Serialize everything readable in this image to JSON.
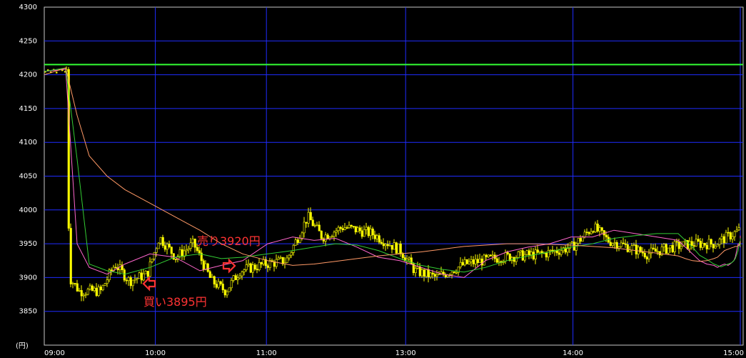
{
  "chart_data": {
    "type": "candlestick",
    "y_axis": {
      "ticks": [
        "4300",
        "4250",
        "4200",
        "4150",
        "4100",
        "4050",
        "4000",
        "3950",
        "3900",
        "3850"
      ],
      "unit_label": "(円)",
      "ylim": [
        3800,
        4300
      ]
    },
    "x_axis": {
      "ticks": [
        "09:00",
        "10:00",
        "11:00",
        "13:00",
        "14:00",
        "15:00"
      ]
    },
    "grid": true,
    "reference_line": {
      "value": 4215,
      "color": "#33ff33"
    },
    "candle_color": "#ffff00",
    "moving_averages": [
      {
        "color": "#ff66cc",
        "values": [
          4205,
          4208,
          3950,
          3915,
          3905,
          3920,
          3935,
          3930,
          3910,
          3918,
          3925,
          3950,
          3960,
          3955,
          3958,
          3945,
          3930,
          3925,
          3915,
          3905,
          3900,
          3925,
          3938,
          3945,
          3950,
          3960,
          3960,
          3970,
          3965,
          3960,
          3955,
          3945,
          3935,
          3925,
          3920,
          3918,
          3915,
          3918,
          3920,
          3918,
          3922,
          3925,
          3930,
          3940,
          3950,
          3950,
          3948,
          3945,
          3950,
          3955,
          3958,
          3960,
          3962
        ]
      },
      {
        "color": "#33cc33",
        "values": [
          4205,
          4210,
          4075,
          3920,
          3910,
          3905,
          3915,
          3930,
          3935,
          3928,
          3930,
          3935,
          3940,
          3945,
          3950,
          3948,
          3940,
          3928,
          3918,
          3912,
          3908,
          3915,
          3925,
          3932,
          3938,
          3945,
          3950,
          3958,
          3962,
          3965,
          3965,
          3955,
          3945,
          3933,
          3927,
          3920,
          3918,
          3916,
          3918,
          3920,
          3922,
          3925,
          3928,
          3934,
          3940,
          3948,
          3952,
          3948,
          3946,
          3948,
          3952,
          3955,
          3958
        ]
      },
      {
        "color": "#ff9966",
        "values": [
          4200,
          4210,
          4140,
          4080,
          4050,
          4030,
          4010,
          3990,
          3970,
          3950,
          3935,
          3925,
          3918,
          3920,
          3924,
          3928,
          3932,
          3935,
          3938,
          3942,
          3946,
          3948,
          3950,
          3950,
          3949,
          3948,
          3946,
          3944,
          3940,
          3936,
          3932,
          3928,
          3925,
          3924,
          3925,
          3928,
          3930,
          3935,
          3940,
          3942,
          3944,
          3945,
          3946,
          3946,
          3947,
          3948,
          3949,
          3950,
          3950,
          3951,
          3952,
          3953,
          3954
        ]
      }
    ],
    "ma_x": [
      "09:00",
      "09:10",
      "09:20",
      "09:30",
      "09:40",
      "09:50",
      "10:00",
      "10:10",
      "10:20",
      "10:30",
      "10:40",
      "10:50",
      "11:00",
      "11:10",
      "11:20",
      "11:30",
      "11:40",
      "11:50",
      "13:00",
      "13:10",
      "13:20",
      "13:30",
      "13:40",
      "13:50",
      "14:00",
      "14:10",
      "14:20",
      "14:30",
      "14:40",
      "14:50",
      "15:00",
      "15:00",
      "15:00",
      "15:00",
      "15:00",
      "15:00",
      "15:00",
      "15:00",
      "15:00",
      "15:00",
      "15:00",
      "15:00",
      "15:00",
      "15:00",
      "15:00",
      "15:00",
      "15:00",
      "15:00",
      "15:00",
      "15:00",
      "15:00",
      "15:00",
      "15:00"
    ],
    "annotations": [
      {
        "label": "売り3920円",
        "time": "10:32",
        "price": 3920,
        "color": "#ff3333"
      },
      {
        "label": "買い3895円",
        "time": "09:44",
        "price": 3895,
        "color": "#ff3333"
      }
    ]
  }
}
